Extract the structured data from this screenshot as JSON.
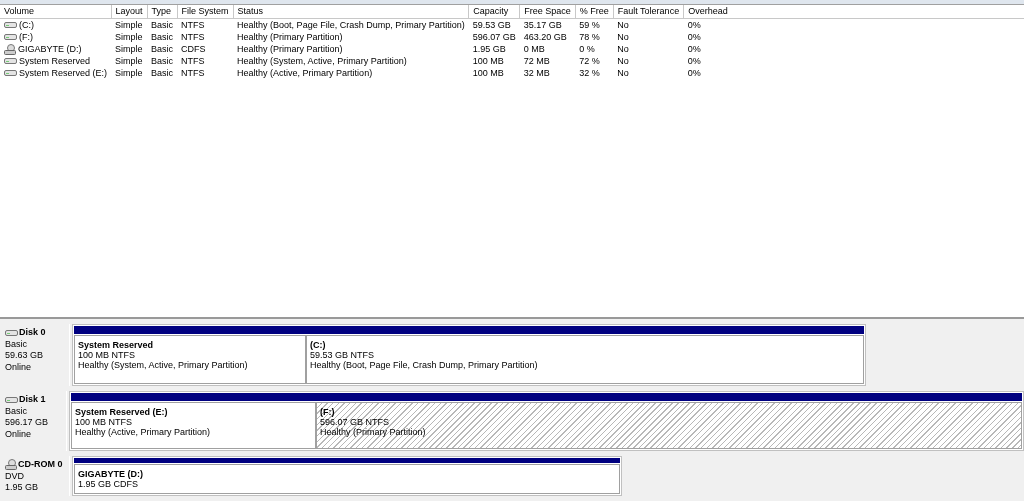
{
  "volume_table": {
    "columns": [
      "Volume",
      "Layout",
      "Type",
      "File System",
      "Status",
      "Capacity",
      "Free Space",
      "% Free",
      "Fault Tolerance",
      "Overhead"
    ],
    "rows": [
      {
        "kind": "disk",
        "cells": [
          "(C:)",
          "Simple",
          "Basic",
          "NTFS",
          "Healthy (Boot, Page File, Crash Dump, Primary Partition)",
          "59.53 GB",
          "35.17 GB",
          "59 %",
          "No",
          "0%"
        ]
      },
      {
        "kind": "disk",
        "cells": [
          "(F:)",
          "Simple",
          "Basic",
          "NTFS",
          "Healthy (Primary Partition)",
          "596.07 GB",
          "463.20 GB",
          "78 %",
          "No",
          "0%"
        ]
      },
      {
        "kind": "cdrom",
        "cells": [
          "GIGABYTE (D:)",
          "Simple",
          "Basic",
          "CDFS",
          "Healthy (Primary Partition)",
          "1.95 GB",
          "0 MB",
          "0 %",
          "No",
          "0%"
        ]
      },
      {
        "kind": "disk",
        "cells": [
          "System Reserved",
          "Simple",
          "Basic",
          "NTFS",
          "Healthy (System, Active, Primary Partition)",
          "100 MB",
          "72 MB",
          "72 %",
          "No",
          "0%"
        ]
      },
      {
        "kind": "disk",
        "cells": [
          "System Reserved (E:)",
          "Simple",
          "Basic",
          "NTFS",
          "Healthy (Active, Primary Partition)",
          "100 MB",
          "32 MB",
          "32 %",
          "No",
          "0%"
        ]
      }
    ]
  },
  "disks": [
    {
      "kind": "disk",
      "name": "Disk 0",
      "lines": [
        "Basic",
        "59.63 GB",
        "Online"
      ],
      "partitions": [
        {
          "name": "System Reserved",
          "size": "100 MB NTFS",
          "status": "Healthy (System, Active, Primary Partition)",
          "selected": false
        },
        {
          "name": "(C:)",
          "size": "59.53 GB NTFS",
          "status": "Healthy (Boot, Page File, Crash Dump, Primary Partition)",
          "selected": false
        }
      ]
    },
    {
      "kind": "disk",
      "name": "Disk 1",
      "lines": [
        "Basic",
        "596.17 GB",
        "Online"
      ],
      "partitions": [
        {
          "name": "System Reserved  (E:)",
          "size": "100 MB NTFS",
          "status": "Healthy (Active, Primary Partition)",
          "selected": false
        },
        {
          "name": "(F:)",
          "size": "596.07 GB NTFS",
          "status": "Healthy (Primary Partition)",
          "selected": true
        }
      ]
    },
    {
      "kind": "cdrom",
      "name": "CD-ROM 0",
      "lines": [
        "DVD",
        "1.95 GB"
      ],
      "partitions": [
        {
          "name": "GIGABYTE  (D:)",
          "size": "1.95 GB CDFS",
          "selected": false
        }
      ]
    }
  ]
}
